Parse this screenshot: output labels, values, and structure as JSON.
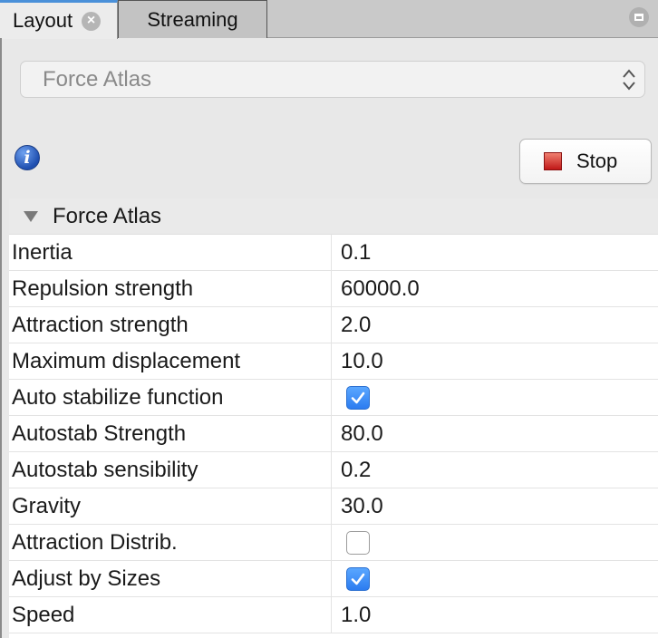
{
  "tabs": [
    {
      "label": "Layout",
      "active": true,
      "closable": true
    },
    {
      "label": "Streaming",
      "active": false
    }
  ],
  "algorithm_select": {
    "value": "Force Atlas"
  },
  "buttons": {
    "stop_label": "Stop"
  },
  "icons": {
    "info": "info-icon",
    "stop": "stop-icon",
    "close": "close-icon",
    "minimize": "minimize-icon"
  },
  "property_group": {
    "title": "Force Atlas",
    "properties": [
      {
        "name": "Inertia",
        "type": "text",
        "value": "0.1"
      },
      {
        "name": "Repulsion strength",
        "type": "text",
        "value": "60000.0"
      },
      {
        "name": "Attraction strength",
        "type": "text",
        "value": "2.0"
      },
      {
        "name": "Maximum displacement",
        "type": "text",
        "value": "10.0"
      },
      {
        "name": "Auto stabilize function",
        "type": "checkbox",
        "checked": true
      },
      {
        "name": "Autostab Strength",
        "type": "text",
        "value": "80.0"
      },
      {
        "name": "Autostab sensibility",
        "type": "text",
        "value": "0.2"
      },
      {
        "name": "Gravity",
        "type": "text",
        "value": "30.0"
      },
      {
        "name": "Attraction Distrib.",
        "type": "checkbox",
        "checked": false
      },
      {
        "name": "Adjust by Sizes",
        "type": "checkbox",
        "checked": true
      },
      {
        "name": "Speed",
        "type": "text",
        "value": "1.0"
      }
    ]
  },
  "colors": {
    "accent": "#4a90d9",
    "checkbox_on": "#2c7cf0",
    "stop_red": "#c01818"
  }
}
